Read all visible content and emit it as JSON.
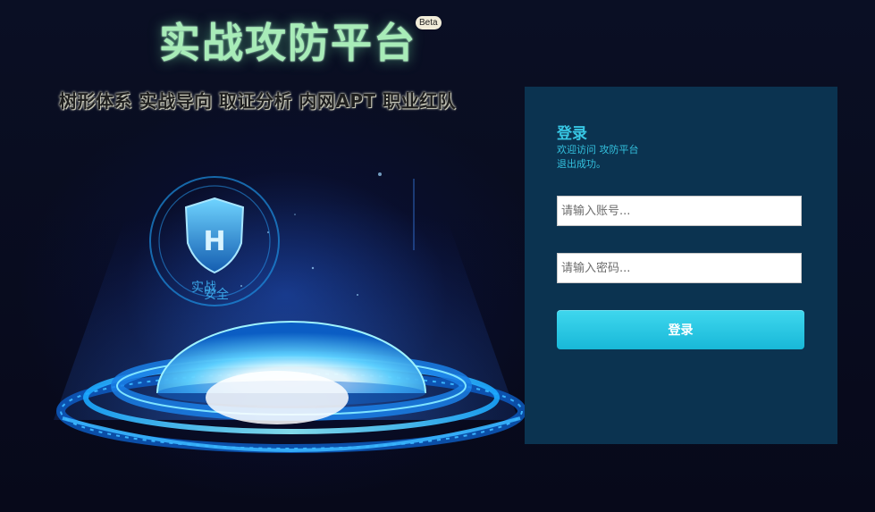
{
  "hero": {
    "title": "实战攻防平台",
    "beta": "Beta",
    "slogan": "树形体系 实战导向 取证分析 内网APT 职业红队",
    "logo_text_top": "实战",
    "logo_text_bottom": "安全",
    "logo_letter": "H"
  },
  "login": {
    "heading": "登录",
    "welcome": "欢迎访问 攻防平台",
    "status": "退出成功。",
    "account_placeholder": "请输入账号...",
    "password_placeholder": "请输入密码...",
    "account_value": "",
    "password_value": "",
    "submit_label": "登录"
  },
  "colors": {
    "panel": "#0b3350",
    "accent": "#37c7e4",
    "title_glow": "#a8ecb8",
    "button": "#1cbcdc"
  },
  "icons": [
    "shield-logo-icon",
    "glowing-dome-icon"
  ]
}
